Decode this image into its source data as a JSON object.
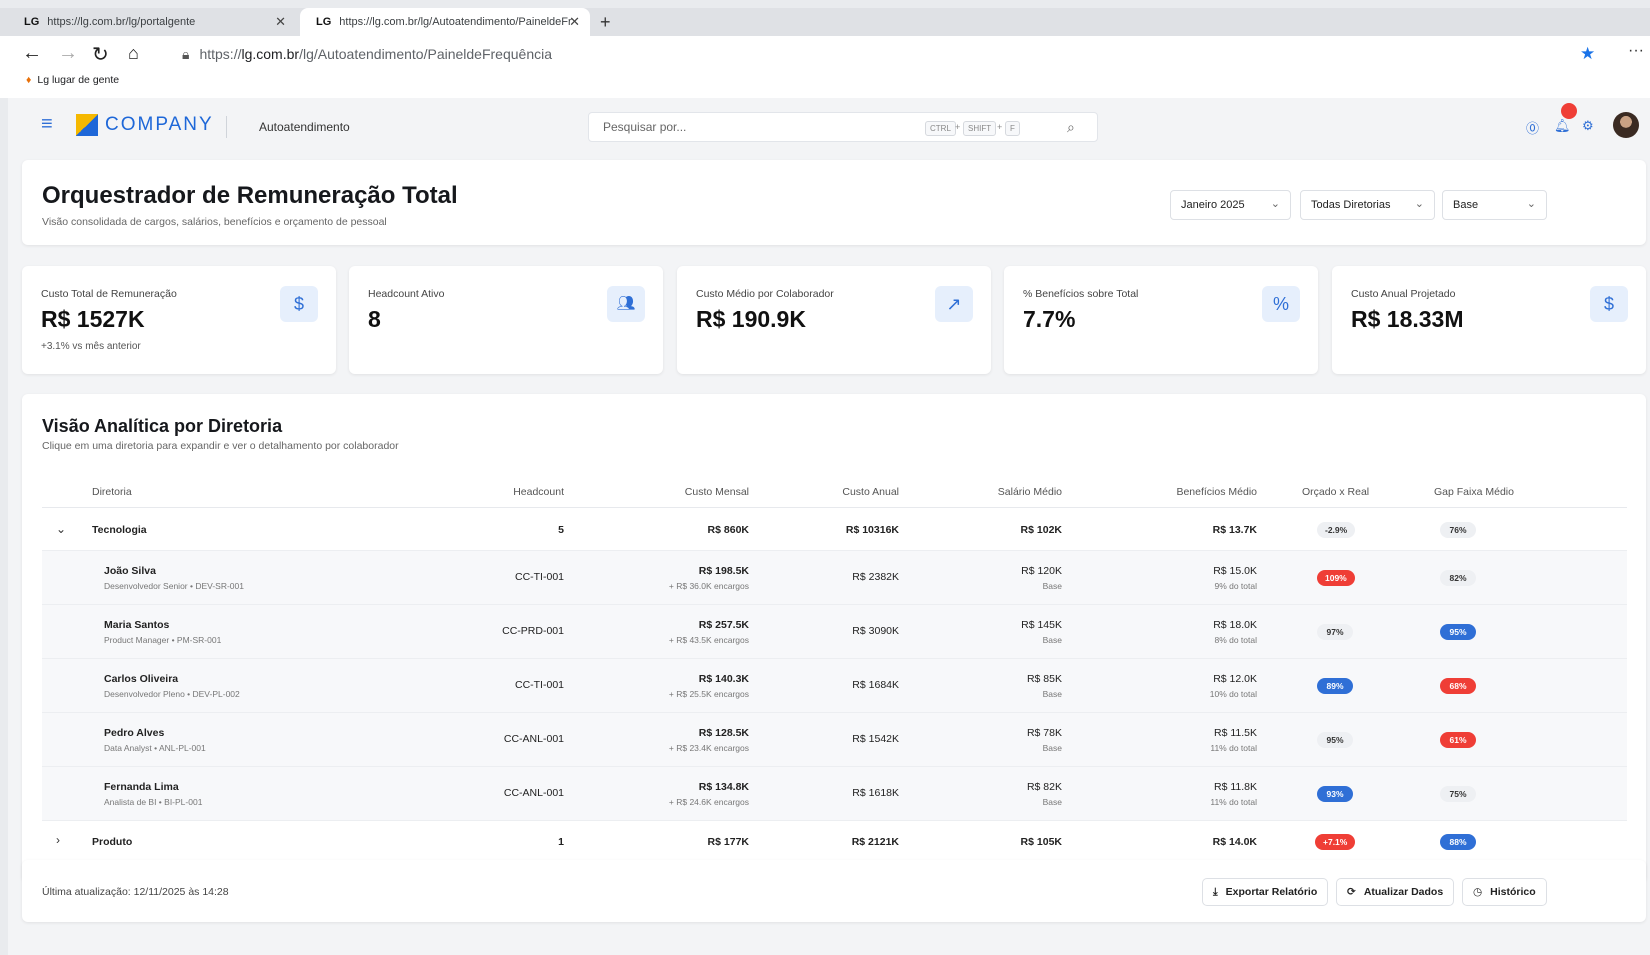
{
  "browser": {
    "tabs": [
      {
        "logo": "LG",
        "title": "https://lg.com.br/lg/portalgente"
      },
      {
        "logo": "LG",
        "title": "https://lg.com.br/lg/Autoatendimento/PaineldeFr"
      }
    ],
    "address": {
      "prefix": "https://",
      "domain": "lg.com.br",
      "path": "/lg/Autoatendimento/PaineldeFrequência"
    },
    "bookmark": "Lg lugar de gente"
  },
  "topnav": {
    "brand": "COMPANY",
    "section": "Autoatendimento",
    "search_placeholder": "Pesquisar por...",
    "shortcut": [
      "CTRL",
      "SHIFT",
      "F"
    ]
  },
  "header": {
    "title": "Orquestrador de Remuneração Total",
    "subtitle": "Visão consolidada de cargos, salários, benefícios e orçamento de pessoal",
    "filters": {
      "period": "Janeiro 2025",
      "directorate": "Todas Diretorias",
      "scenario": "Base"
    }
  },
  "kpis": [
    {
      "label": "Custo Total de Remuneração",
      "value": "R$ 1527K",
      "sub": "+3.1% vs mês anterior",
      "icon": "dollar-icon"
    },
    {
      "label": "Headcount Ativo",
      "value": "8",
      "sub": "",
      "icon": "users-icon"
    },
    {
      "label": "Custo Médio por Colaborador",
      "value": "R$ 190.9K",
      "sub": "",
      "icon": "trending-up-icon"
    },
    {
      "label": "% Benefícios sobre Total",
      "value": "7.7%",
      "sub": "",
      "icon": "percent-icon"
    },
    {
      "label": "Custo Anual Projetado",
      "value": "R$ 18.33M",
      "sub": "",
      "icon": "dollar-icon"
    }
  ],
  "table": {
    "title": "Visão Analítica por Diretoria",
    "subtitle": "Clique em uma diretoria para expandir e ver o detalhamento por colaborador",
    "columns": [
      "Diretoria",
      "Headcount",
      "Custo Mensal",
      "Custo Anual",
      "Salário Médio",
      "Benefícios Médio",
      "Orçado x Real",
      "Gap Faixa Médio"
    ],
    "groups": [
      {
        "name": "Tecnologia",
        "expanded": true,
        "headcount": "5",
        "monthly": "R$ 860K",
        "annual": "R$ 10316K",
        "salary": "R$ 102K",
        "benefits": "R$ 13.7K",
        "budget": {
          "text": "-2.9%",
          "tone": "gray"
        },
        "gap": {
          "text": "76%",
          "tone": "gray"
        },
        "members": [
          {
            "name": "João Silva",
            "role": "Desenvolvedor Senior • DEV-SR-001",
            "cc": "CC-TI-001",
            "monthly": "R$ 198.5K",
            "charges": "+ R$ 36.0K encargos",
            "annual": "R$ 2382K",
            "salary": "R$ 120K",
            "salary_sub": "Base",
            "benefits": "R$ 15.0K",
            "benefits_sub": "9% do total",
            "budget": {
              "text": "109%",
              "tone": "red"
            },
            "gap": {
              "text": "82%",
              "tone": "gray"
            }
          },
          {
            "name": "Maria Santos",
            "role": "Product Manager • PM-SR-001",
            "cc": "CC-PRD-001",
            "monthly": "R$ 257.5K",
            "charges": "+ R$ 43.5K encargos",
            "annual": "R$ 3090K",
            "salary": "R$ 145K",
            "salary_sub": "Base",
            "benefits": "R$ 18.0K",
            "benefits_sub": "8% do total",
            "budget": {
              "text": "97%",
              "tone": "gray"
            },
            "gap": {
              "text": "95%",
              "tone": "blue"
            }
          },
          {
            "name": "Carlos Oliveira",
            "role": "Desenvolvedor Pleno • DEV-PL-002",
            "cc": "CC-TI-001",
            "monthly": "R$ 140.3K",
            "charges": "+ R$ 25.5K encargos",
            "annual": "R$ 1684K",
            "salary": "R$ 85K",
            "salary_sub": "Base",
            "benefits": "R$ 12.0K",
            "benefits_sub": "10% do total",
            "budget": {
              "text": "89%",
              "tone": "blue"
            },
            "gap": {
              "text": "68%",
              "tone": "red"
            }
          },
          {
            "name": "Pedro Alves",
            "role": "Data Analyst • ANL-PL-001",
            "cc": "CC-ANL-001",
            "monthly": "R$ 128.5K",
            "charges": "+ R$ 23.4K encargos",
            "annual": "R$ 1542K",
            "salary": "R$ 78K",
            "salary_sub": "Base",
            "benefits": "R$ 11.5K",
            "benefits_sub": "11% do total",
            "budget": {
              "text": "95%",
              "tone": "gray"
            },
            "gap": {
              "text": "61%",
              "tone": "red"
            }
          },
          {
            "name": "Fernanda Lima",
            "role": "Analista de BI • BI-PL-001",
            "cc": "CC-ANL-001",
            "monthly": "R$ 134.8K",
            "charges": "+ R$ 24.6K encargos",
            "annual": "R$ 1618K",
            "salary": "R$ 82K",
            "salary_sub": "Base",
            "benefits": "R$ 11.8K",
            "benefits_sub": "11% do total",
            "budget": {
              "text": "93%",
              "tone": "blue"
            },
            "gap": {
              "text": "75%",
              "tone": "gray"
            }
          }
        ]
      },
      {
        "name": "Produto",
        "expanded": false,
        "headcount": "1",
        "monthly": "R$ 177K",
        "annual": "R$ 2121K",
        "salary": "R$ 105K",
        "benefits": "R$ 14.0K",
        "budget": {
          "text": "+7.1%",
          "tone": "red"
        },
        "gap": {
          "text": "88%",
          "tone": "blue"
        },
        "members": []
      }
    ]
  },
  "footer": {
    "updated": "Última atualização: 12/11/2025 às 14:28",
    "buttons": [
      "Exportar Relatório",
      "Atualizar Dados",
      "Histórico"
    ]
  },
  "colors": {
    "accent": "#2f6fd6",
    "danger": "#ef3e36",
    "brand_yellow": "#f5b800"
  }
}
